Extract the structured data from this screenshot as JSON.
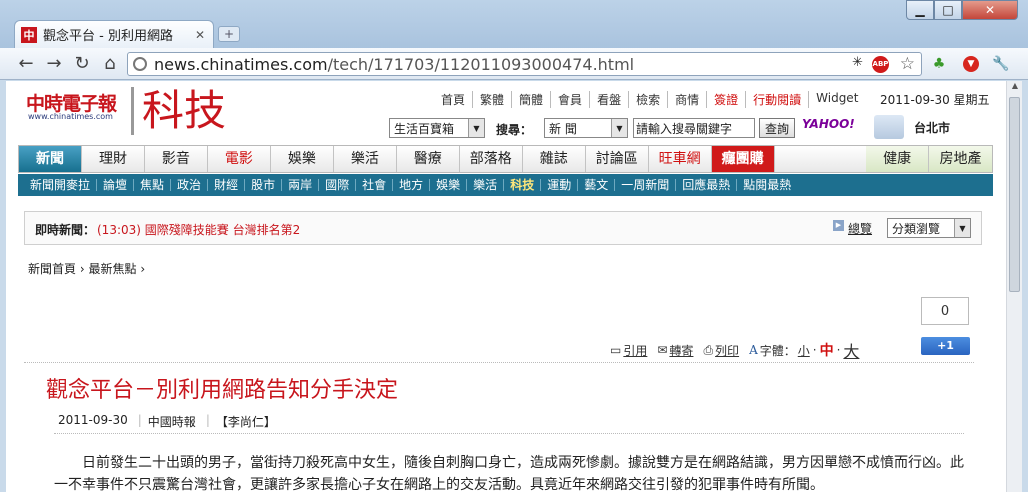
{
  "browser": {
    "tab_title": "觀念平台 - 別利用網路",
    "favicon_text": "中",
    "url_host": "news.chinatimes.com",
    "url_path": "/tech/171703/112011093000474.html"
  },
  "site": {
    "logo": "中時電子報",
    "logo_sub": "www.chinatimes.com",
    "section": "科技",
    "top_links": [
      "首頁",
      "繁體",
      "簡體",
      "會員",
      "看盤",
      "檢索",
      "商情",
      "簽證",
      "行動閱讀",
      "Widget"
    ],
    "date": "2011-09-30 星期五",
    "category_select": "生活百寶箱",
    "search_label": "搜尋：",
    "search_select": "新 聞",
    "search_placeholder": "請輸入搜尋關鍵字",
    "search_button": "查詢",
    "yahoo": "YAHOO!",
    "city": "台北市"
  },
  "main_nav": [
    "新聞",
    "理財",
    "影音",
    "電影",
    "娛樂",
    "樂活",
    "醫療",
    "部落格",
    "雜誌",
    "討論區",
    "旺車網",
    "癮團購",
    "健康",
    "房地產"
  ],
  "sub_nav": [
    "新聞開麥拉",
    "論壇",
    "焦點",
    "政治",
    "財經",
    "股市",
    "兩岸",
    "國際",
    "社會",
    "地方",
    "娛樂",
    "樂活",
    "科技",
    "運動",
    "藝文",
    "一周新聞",
    "回應最熱",
    "點閱最熱"
  ],
  "breaking": {
    "label": "即時新聞：",
    "item": "(13:03) 國際殘障技能賽 台灣排名第2",
    "overview": "總覽",
    "browse": "分類瀏覽"
  },
  "breadcrumb": [
    "新聞首頁",
    "最新焦點"
  ],
  "tools": {
    "cite": "引用",
    "forward": "轉寄",
    "print": "列印",
    "font_label": "字體：",
    "small": "小",
    "medium": "中",
    "large": "大",
    "count": "0",
    "plus": "+1"
  },
  "article": {
    "headline": "觀念平台－別利用網路告知分手決定",
    "date": "2011-09-30",
    "source": "中國時報",
    "author": "【李尚仁】",
    "body": "日前發生二十出頭的男子，當街持刀殺死高中女生，隨後自刺胸口身亡，造成兩死慘劇。據說雙方是在網路結識，男方因單戀不成憤而行凶。此一不幸事件不只震驚台灣社會，更讓許多家長擔心子女在網路上的交友活動。具竟近年來網路交往引發的犯罪事件時有所聞。"
  }
}
